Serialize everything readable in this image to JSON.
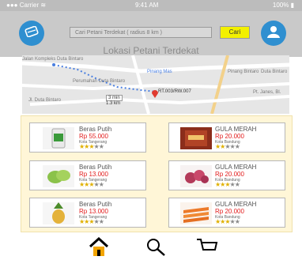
{
  "status_bar": {
    "left": "●●● Carrier ≋",
    "time": "9:41 AM",
    "right": "100% ▮"
  },
  "header": {
    "menu_icon": "menu-icon",
    "user_icon": "user-icon",
    "search": {
      "placeholder": "Cari Petani Terdekat ( radius 8 km )",
      "button": "Cari"
    }
  },
  "map": {
    "title": "Lokasi Petani Terdekat",
    "labels": [
      "Jalan Kompleks Duta Bintaro",
      "Perumahan Duta Bintaro",
      "Pinang Mas",
      "Pinang Bintaro",
      "Duta Bintaro",
      "3 min",
      "1.3 km",
      "RT.003/RW.007",
      "Jl. Duta Bintaro",
      "Pt. Janes, Bl."
    ]
  },
  "products": [
    {
      "name": "Beras Putih",
      "price": "Rp 55.000",
      "location": "Kota Tangerang",
      "rating": 3,
      "thumb": "beras-sack"
    },
    {
      "name": "GULA MERAH",
      "price": "Rp 20.000",
      "location": "Kota Bandung",
      "rating": 2,
      "thumb": "gula-merah-pack"
    },
    {
      "name": "Beras Putih",
      "price": "Rp 13.000",
      "location": "Kota Tangerang",
      "rating": 3,
      "thumb": "green-fruit"
    },
    {
      "name": "GULA MERAH",
      "price": "Rp 20.000",
      "location": "Kota Bandung",
      "rating": 3,
      "thumb": "red-onion"
    },
    {
      "name": "Beras Putih",
      "price": "Rp 13.000",
      "location": "Kota Tangerang",
      "rating": 3,
      "thumb": "pineapple"
    },
    {
      "name": "GULA MERAH",
      "price": "Rp 20.000",
      "location": "Kota Bandung",
      "rating": 3,
      "thumb": "carrots"
    }
  ],
  "bottom_nav": [
    "home-icon",
    "search-icon",
    "cart-icon"
  ],
  "colors": {
    "accent_blue": "#2f8fd0",
    "price_red": "#e21b1b",
    "button_yellow": "#f3f000",
    "star_gold": "#e0b000",
    "panel_bg": "#fff6d7"
  }
}
